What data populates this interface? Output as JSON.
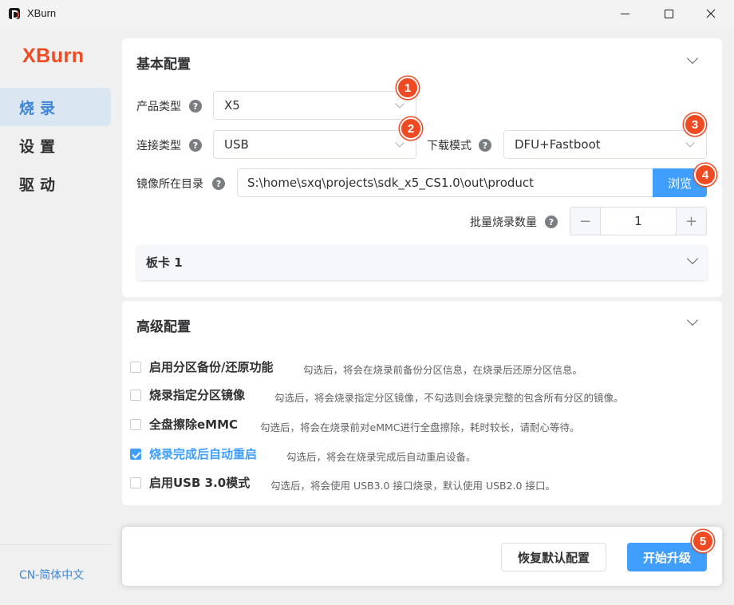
{
  "window": {
    "title": "XBurn"
  },
  "sidebar": {
    "brand": "XBurn",
    "items": [
      {
        "label": "烧录",
        "active": true
      },
      {
        "label": "设置",
        "active": false
      },
      {
        "label": "驱动",
        "active": false
      }
    ],
    "language": "CN-简体中文"
  },
  "basic": {
    "title": "基本配置",
    "product_type": {
      "label": "产品类型",
      "value": "X5"
    },
    "connection_type": {
      "label": "连接类型",
      "value": "USB"
    },
    "download_mode": {
      "label": "下载模式",
      "value": "DFU+Fastboot"
    },
    "image_dir": {
      "label": "镜像所在目录",
      "value": "S:\\home\\sxq\\projects\\sdk_x5_CS1.0\\out\\product",
      "browse_label": "浏览"
    },
    "batch_count": {
      "label": "批量烧录数量",
      "value": "1",
      "minus": "−",
      "plus": "+"
    },
    "board": {
      "title": "板卡 1"
    },
    "help_glyph": "?"
  },
  "advanced": {
    "title": "高级配置",
    "options": [
      {
        "label": "启用分区备份/还原功能",
        "desc": "勾选后，将会在烧录前备份分区信息，在烧录后还原分区信息。",
        "checked": false
      },
      {
        "label": "烧录指定分区镜像",
        "desc": "勾选后，将会烧录指定分区镜像，不勾选则会烧录完整的包含所有分区的镜像。",
        "checked": false
      },
      {
        "label": "全盘擦除eMMC",
        "desc": "勾选后，将会在烧录前对eMMC进行全盘擦除，耗时较长，请耐心等待。",
        "checked": false
      },
      {
        "label": "烧录完成后自动重启",
        "desc": "勾选后，将会在烧录完成后自动重启设备。",
        "checked": true
      },
      {
        "label": "启用USB 3.0模式",
        "desc": "勾选后，将会使用 USB3.0 接口烧录，默认使用 USB2.0 接口。",
        "checked": false
      }
    ]
  },
  "footer": {
    "reset_label": "恢复默认配置",
    "start_label": "开始升级"
  },
  "badges": [
    "1",
    "2",
    "3",
    "4",
    "5"
  ],
  "colors": {
    "brand": "#f04a23",
    "accent": "#409eff",
    "badge": "#f04a23"
  }
}
